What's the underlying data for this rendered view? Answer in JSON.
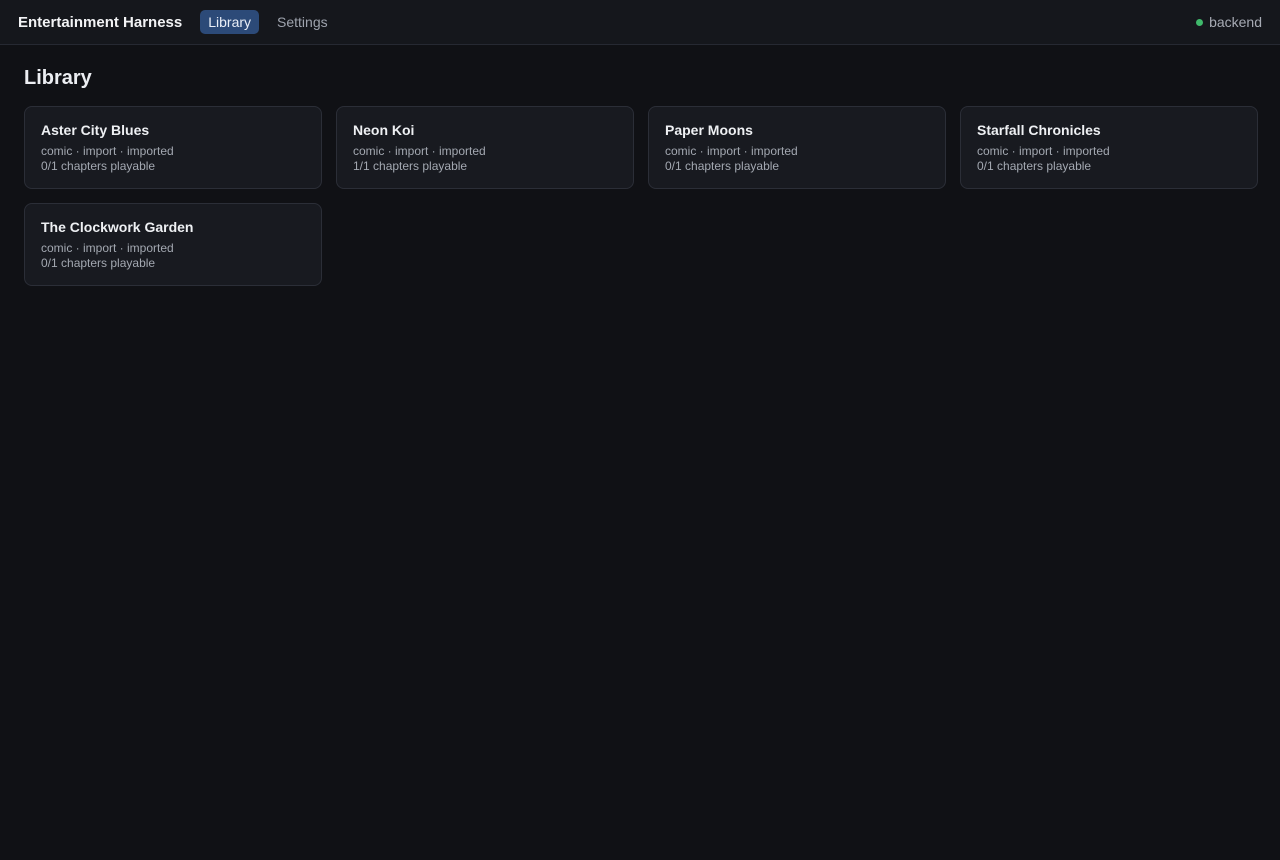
{
  "header": {
    "brand": "Entertainment Harness",
    "tabs": [
      {
        "label": "Library",
        "active": true
      },
      {
        "label": "Settings",
        "active": false
      }
    ],
    "status": {
      "label": "backend",
      "color": "#3fb96b"
    }
  },
  "main": {
    "title": "Library",
    "items": [
      {
        "title": "Aster City Blues",
        "meta": "comic · import · imported",
        "progress": "0/1 chapters playable"
      },
      {
        "title": "Neon Koi",
        "meta": "comic · import · imported",
        "progress": "1/1 chapters playable"
      },
      {
        "title": "Paper Moons",
        "meta": "comic · import · imported",
        "progress": "0/1 chapters playable"
      },
      {
        "title": "Starfall Chronicles",
        "meta": "comic · import · imported",
        "progress": "0/1 chapters playable"
      },
      {
        "title": "The Clockwork Garden",
        "meta": "comic · import · imported",
        "progress": "0/1 chapters playable"
      }
    ]
  }
}
